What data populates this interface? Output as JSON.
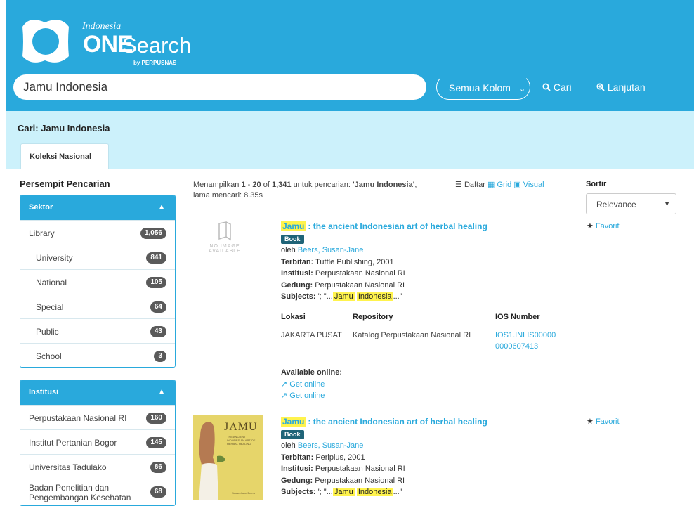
{
  "header": {
    "brand_top": "Indonesia",
    "brand_one": "ONE",
    "brand_search": "Search",
    "brand_by": "by PERPUSNAS",
    "search_value": "Jamu Indonesia",
    "scope": "Semua Kolom",
    "search_button": "Cari",
    "advanced_button": "Lanjutan"
  },
  "bar": {
    "title": "Cari: Jamu Indonesia",
    "tab": "Koleksi Nasional"
  },
  "sidebar": {
    "title": "Persempit Pencarian",
    "sektor": {
      "title": "Sektor",
      "items": [
        {
          "label": "Library",
          "count": "1,056",
          "sub": false
        },
        {
          "label": "University",
          "count": "841",
          "sub": true
        },
        {
          "label": "National",
          "count": "105",
          "sub": true
        },
        {
          "label": "Special",
          "count": "64",
          "sub": true
        },
        {
          "label": "Public",
          "count": "43",
          "sub": true
        },
        {
          "label": "School",
          "count": "3",
          "sub": true
        }
      ]
    },
    "institusi": {
      "title": "Institusi",
      "items": [
        {
          "label": "Perpustakaan Nasional RI",
          "count": "160"
        },
        {
          "label": "Institut Pertanian Bogor",
          "count": "145"
        },
        {
          "label": "Universitas Tadulako",
          "count": "86"
        },
        {
          "label": "Badan Penelitian dan Pengembangan Kesehatan",
          "count": "68"
        }
      ]
    }
  },
  "results": {
    "info_prefix": "Menampilkan",
    "range_start": "1",
    "range_sep": "-",
    "range_end": "20",
    "of": "of",
    "total": "1,341",
    "query_label": "untuk pencarian:",
    "query": "'Jamu Indonesia'",
    "time_label": "lama mencari: 8.35s",
    "view_list": "Daftar",
    "view_grid": "Grid",
    "view_visual": "Visual",
    "sort_label": "Sortir",
    "sort_value": "Relevance",
    "no_image_1": "NO IMAGE",
    "no_image_2": "AVAILABLE",
    "cover_title": "JAMU",
    "cover_sub": "THE ANCIENT INDONESIAN ART OF HERBAL HEALING",
    "cover_author": "Susan-Jane Beers",
    "favorite": "Favorit",
    "records": [
      {
        "title_hl": "Jamu",
        "title_rest": ": the ancient Indonesian art of herbal healing",
        "format": "Book",
        "by": "oleh",
        "author": "Beers, Susan-Jane",
        "pub_label": "Terbitan:",
        "pub": "Tuttle Publishing, 2001",
        "inst_label": "Institusi:",
        "inst": "Perpustakaan Nasional RI",
        "bldg_label": "Gedung:",
        "bldg": "Perpustakaan Nasional RI",
        "subj_label": "Subjects:",
        "subj_pre": "'; \"...",
        "subj_hl1": "Jamu",
        "subj_hl2": "Indonesia",
        "subj_post": "...\""
      },
      {
        "title_hl": "Jamu",
        "title_rest": ": the ancient Indonesian art of herbal healing",
        "format": "Book",
        "by": "oleh",
        "author": "Beers, Susan-Jane",
        "pub_label": "Terbitan:",
        "pub": "Periplus, 2001",
        "inst_label": "Institusi:",
        "inst": "Perpustakaan Nasional RI",
        "bldg_label": "Gedung:",
        "bldg": "Perpustakaan Nasional RI",
        "subj_label": "Subjects:",
        "subj_pre": "'; \"...",
        "subj_hl1": "Jamu",
        "subj_hl2": "Indonesia",
        "subj_post": "...\""
      }
    ],
    "holdings": {
      "headers": [
        "Lokasi",
        "Repository",
        "IOS Number"
      ],
      "row": {
        "lokasi": "JAKARTA PUSAT",
        "repo": "Katalog Perpustakaan Nasional RI",
        "ios1": "IOS1.INLIS00000",
        "ios2": "0000607413"
      }
    },
    "online_label": "Available online:",
    "online_links": [
      "Get online",
      "Get online"
    ]
  },
  "colors": {
    "brand": "#29a9dc",
    "bar": "#ccf1fb",
    "badge": "#5a5a5a",
    "highlight": "#fff34d"
  }
}
